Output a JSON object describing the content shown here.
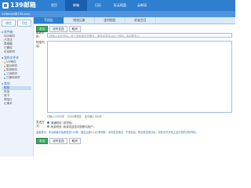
{
  "header": {
    "logo_text": "139邮箱",
    "nav_tabs": [
      "首页",
      "邮箱",
      "日历",
      "彩云网盘",
      "云邮局"
    ],
    "active_tab_index": 1
  },
  "user": {
    "account": "139email@139.com"
  },
  "sidebar": {
    "quick_buttons": [
      "收信",
      "写信"
    ],
    "sections": [
      {
        "title": "收件箱",
        "items": [
          "待办邮件",
          "已发送",
          "草稿箱",
          "已删除",
          "垃圾邮件"
        ]
      },
      {
        "title": "我的文件夹",
        "items": [
          "VIP邮件",
          "星标邮件",
          "账单邮件",
          "订阅邮件",
          "已删除邮件"
        ]
      },
      {
        "title": "其他",
        "items": [
          "短信",
          "彩信",
          "贺卡",
          "明信片",
          "记事本"
        ]
      }
    ],
    "active_item": "短信"
  },
  "compose": {
    "tabs": [
      "写短信",
      "短信记录",
      "定时短信",
      "好友生日"
    ],
    "active_tab_index": 0,
    "top_actions": [
      "发送",
      "定时发送",
      "取消"
    ],
    "recipient_label": "接收手机:",
    "recipient_placeholder": "请输入手机号码，多个号码用逗号隔开，最多可发给100个号码，添加联系人",
    "content_label": "短信内容:",
    "content_placeholder": "",
    "counter": [
      "已输入0/350字",
      "已分0条短信",
      "还可输入350字"
    ],
    "option_label": "发送方式:",
    "options": [
      "普通短信 (发短信)",
      "免费短信 (免费发送给中国移动用户)"
    ],
    "selected_option_index": 0,
    "note": "温馨提示：本功能每月免费发送100条，超出后按0.1元/条收取，请勿发送违法、不良信息。短信发送成功后，将在对方手机上显示您的手机号码。",
    "bottom_actions": [
      "发送",
      "定时发送",
      "取消"
    ]
  }
}
